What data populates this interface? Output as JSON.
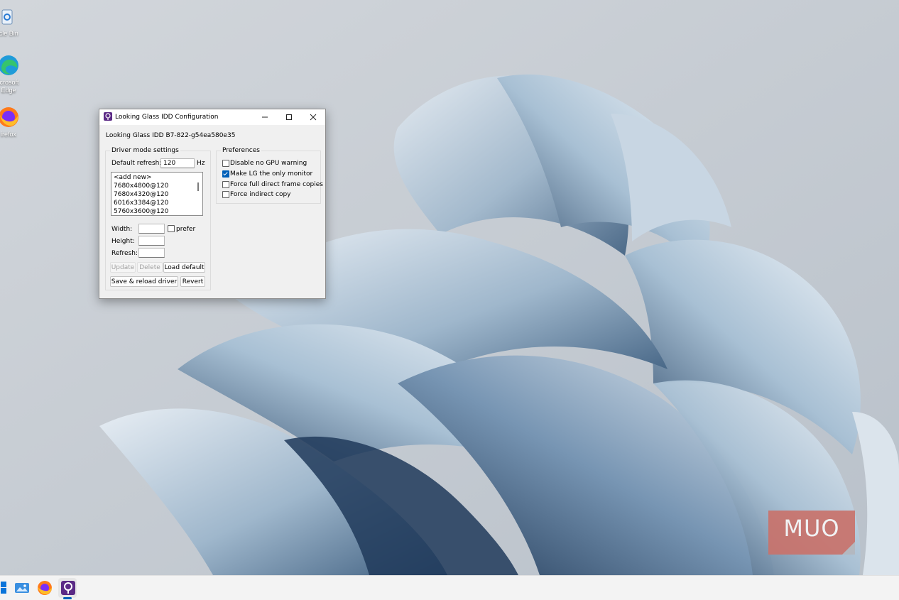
{
  "desktop": {
    "icons": [
      {
        "label": "ycle Bin",
        "icon": "recycle-bin-icon"
      },
      {
        "label": "icrosoft\nEdge",
        "icon": "edge-icon"
      },
      {
        "label": "irefox",
        "icon": "firefox-icon"
      }
    ],
    "watermark": "MUO"
  },
  "window": {
    "title": "Looking Glass IDD Configuration",
    "title_icon": "looking-glass-icon",
    "driver_version": "Looking Glass IDD B7-822-g54ea580e35",
    "driver_mode": {
      "legend": "Driver mode settings",
      "default_refresh_label": "Default refresh:",
      "default_refresh_value": "120",
      "hz_label": "Hz",
      "modes": [
        "<add new>",
        "7680x4800@120",
        "7680x4320@120",
        "6016x3384@120",
        "5760x3600@120"
      ],
      "width_label": "Width:",
      "width_value": "",
      "prefer_label": "prefer",
      "prefer_checked": false,
      "height_label": "Height:",
      "height_value": "",
      "refresh_label": "Refresh:",
      "refresh_value": "",
      "update_label": "Update",
      "delete_label": "Delete",
      "load_default_label": "Load default",
      "save_reload_label": "Save & reload driver",
      "revert_label": "Revert"
    },
    "preferences": {
      "legend": "Preferences",
      "options": [
        {
          "label": "Disable no GPU warning",
          "checked": false
        },
        {
          "label": "Make LG the only monitor",
          "checked": true
        },
        {
          "label": "Force full direct frame copies",
          "checked": false
        },
        {
          "label": "Force indirect copy",
          "checked": false
        }
      ]
    }
  },
  "taskbar": {
    "items": [
      "start-icon",
      "gallery-icon",
      "firefox-icon",
      "looking-glass-icon"
    ],
    "active": "looking-glass-icon"
  },
  "colors": {
    "accent": "#005fb8",
    "watermark": "#c9736c"
  }
}
